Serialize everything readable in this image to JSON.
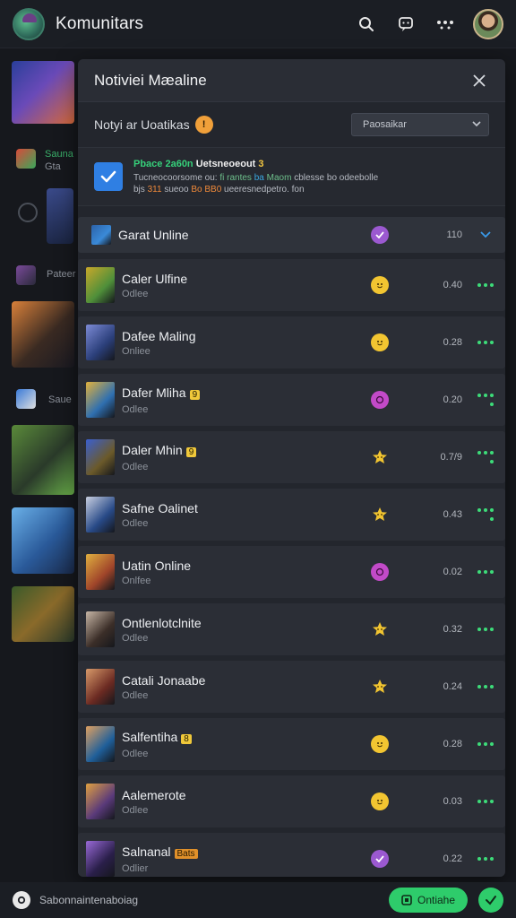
{
  "header": {
    "title": "Komunitars",
    "icons": [
      "search-icon",
      "chat-icon",
      "more-icon"
    ],
    "avatar": "user-avatar"
  },
  "background": {
    "items": [
      {
        "label": "Sauna",
        "sub": "Gta"
      },
      {
        "label": "Pateer"
      },
      {
        "label": "Saue"
      }
    ]
  },
  "panel": {
    "title": "Notiviei Mæaline",
    "filter_label": "Notyi ar Uoatikas",
    "filter_badge": "!",
    "filter_select": "Paosaikar",
    "notice": {
      "title_a": "Pbace 2a60n",
      "title_b": "Uetsneoeout",
      "title_c": "3",
      "line1_a": "Tucneocoorsome ou:",
      "line1_b": "fi",
      "line1_c": "rantes",
      "line1_d": "ba",
      "line1_e": "Maom",
      "line1_f": "cblesse bo odeebolle",
      "line2_a": "bjs",
      "line2_b": "311",
      "line2_c": "sueoo",
      "line2_d": "Bo",
      "line2_e": "BB0",
      "line2_f": "ueeresnedpetro. fon"
    },
    "rows": [
      {
        "title": "Garat Unline",
        "sub": "",
        "count": "110",
        "status": "check-purple",
        "action": "chevron",
        "thumb": "#3a8ad8",
        "accent": "#2c62a8"
      },
      {
        "title": "Caler Ulfine",
        "sub": "Odlee",
        "count": "0.40",
        "status": "face-yellow",
        "action": "dots",
        "thumb": "#4f8f3a",
        "accent": "#c9a82a"
      },
      {
        "title": "Dafee Maling",
        "sub": "Onliee",
        "count": "0.28",
        "status": "face-yellow",
        "action": "dots",
        "thumb": "#2b3f7a",
        "accent": "#7d8bd6"
      },
      {
        "title": "Dafer Mliha",
        "tag": "9",
        "sub": "Odlee",
        "count": "0.20",
        "status": "face-purple",
        "action": "dots2",
        "thumb": "#2f6fb0",
        "accent": "#e3b23c"
      },
      {
        "title": "Daler Mhin",
        "tag": "9",
        "sub": "Odlee",
        "count": "0.7/9",
        "status": "star-yellow",
        "action": "dots2",
        "thumb": "#6b5a2a",
        "accent": "#3a5fd0"
      },
      {
        "title": "Safne Oalinet",
        "sub": "Odlee",
        "count": "0.43",
        "status": "star-yellow",
        "action": "dots2",
        "thumb": "#284a88",
        "accent": "#c9cfe0"
      },
      {
        "title": "Uatin Online",
        "sub": "Onlfee",
        "count": "0.02",
        "status": "face-purple",
        "action": "dots",
        "thumb": "#a0452a",
        "accent": "#e0b040"
      },
      {
        "title": "Ontlenlotclnite",
        "sub": "Odlee",
        "count": "0.32",
        "status": "star-yellow",
        "action": "dots",
        "thumb": "#3b2e28",
        "accent": "#c7b6a6"
      },
      {
        "title": "Catali Jonaabe",
        "sub": "Odlee",
        "count": "0.24",
        "status": "star-yellow",
        "action": "dots",
        "thumb": "#6b2a22",
        "accent": "#d89a6a"
      },
      {
        "title": "Salfentiha",
        "tag": "8",
        "sub": "Odlee",
        "count": "0.28",
        "status": "face-yellow",
        "action": "dots",
        "thumb": "#1f5f9a",
        "accent": "#e0a060"
      },
      {
        "title": "Aalemerote",
        "sub": "Odlee",
        "count": "0.03",
        "status": "face-yellow",
        "action": "dots",
        "thumb": "#5a3a7a",
        "accent": "#e0a040"
      },
      {
        "title": "Salnanal",
        "tag": "Bats",
        "sub": "Odlier",
        "count": "0.22",
        "status": "check-purple",
        "action": "dots",
        "thumb": "#2a1f4a",
        "accent": "#9a6ad8"
      }
    ]
  },
  "bottom": {
    "label": "Sabonnaintenaboiag",
    "online_button": "Ontiahe",
    "fab": "add-icon"
  },
  "colors": {
    "accent_green": "#2ecc6b",
    "checkbox_blue": "#2f7fe3",
    "badge_orange": "#f0a03a",
    "status_purple": "#9b59d0",
    "status_yellow": "#f2c531"
  }
}
